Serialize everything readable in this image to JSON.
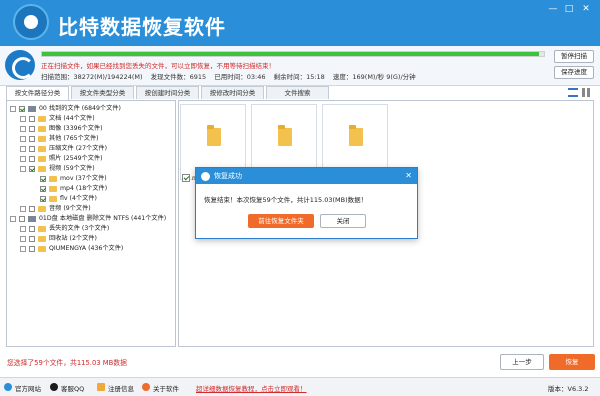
{
  "app": {
    "title": "比特数据恢复软件",
    "window_controls": [
      "—",
      "□",
      "✕"
    ]
  },
  "scan": {
    "progress_percent": 99,
    "message": "正在扫描文件，如果已经找到您丢失的文件，可以立即恢复，不用等待扫描结束！",
    "stats": {
      "range": "扫描范围：38272(M)/194224(M)",
      "found": "发现文件数：6915",
      "elapsed": "已用时间：03:46",
      "remaining": "剩余时间：15:18",
      "speed": "速度：169(M)/秒 9(G)/分钟"
    },
    "pause_label": "暂停扫描",
    "save_label": "保存进度"
  },
  "tabs": [
    {
      "label": "按文件路径分类",
      "active": true
    },
    {
      "label": "按文件类型分类",
      "active": false
    },
    {
      "label": "按创建时间分类",
      "active": false
    },
    {
      "label": "按修改时间分类",
      "active": false
    },
    {
      "label": "文件搜索",
      "active": false
    }
  ],
  "tree": [
    {
      "label": "00 找到的文件",
      "count": "(6849个文件)"
    },
    {
      "label": "文档",
      "count": "(44个文件)"
    },
    {
      "label": "图像",
      "count": "(3396个文件)"
    },
    {
      "label": "其他",
      "count": "(765个文件)"
    },
    {
      "label": "压缩文件",
      "count": "(27个文件)"
    },
    {
      "label": "照片",
      "count": "(2549个文件)"
    },
    {
      "label": "视频",
      "count": "(59个文件)"
    },
    {
      "label": "mov",
      "count": "(37个文件)"
    },
    {
      "label": "mp4",
      "count": "(18个文件)"
    },
    {
      "label": "flv",
      "count": "(4个文件)"
    },
    {
      "label": "音频",
      "count": "(9个文件)"
    },
    {
      "label": "01D盘 本地磁盘 删除文件 NTFS",
      "count": "(441个文件)"
    },
    {
      "label": "丢失的文件",
      "count": "(3个文件)"
    },
    {
      "label": "回收站",
      "count": "(2个文件)"
    },
    {
      "label": "QIUMENGYA",
      "count": "(436个文件)"
    }
  ],
  "card_label": "m",
  "dialog": {
    "title": "恢复成功",
    "message": "恢复结束！本次恢复59个文件，共计115.03(MB)数据！",
    "open_label": "前往恢复文件夹",
    "close_label": "关闭"
  },
  "footer": {
    "selection": "您选择了59个文件，共115.03 MB数据",
    "prev_label": "上一步",
    "recover_label": "恢复"
  },
  "bottom_bar": {
    "website": "官方网站",
    "support": "客服QQ",
    "register": "注册信息",
    "about": "关于软件",
    "tutorial": "超详细数据恢复教程，点击立即观看！",
    "version": "版本：V6.3.2"
  },
  "colors": {
    "brand_blue": "#2a8fd8",
    "accent_orange": "#f06a2a",
    "alert_red": "#d12a2a",
    "progress_green": "#3cc23c"
  }
}
